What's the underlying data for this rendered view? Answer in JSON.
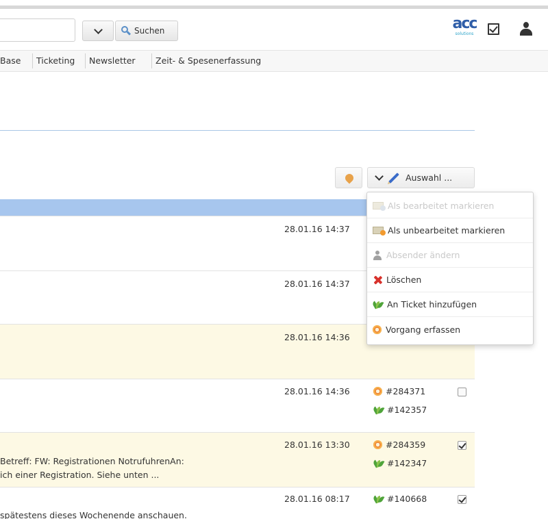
{
  "header": {
    "search_dropdown_icon": "chevron-down-icon",
    "search_button_label": "Suchen",
    "logo_text_main": "acc",
    "logo_text_sub": "solutions"
  },
  "nav": {
    "items": [
      "Base",
      "Ticketing",
      "Newsletter",
      "Zeit- & Spesenerfassung"
    ]
  },
  "toolbar": {
    "select_label": "Auswahl ..."
  },
  "menu": {
    "items": [
      {
        "label": "Als bearbeitet markieren",
        "icon": "mail-icon",
        "disabled": true
      },
      {
        "label": "Als unbearbeitet markieren",
        "icon": "mail-unread-icon",
        "disabled": false
      },
      {
        "label": "Absender ändern",
        "icon": "person-icon",
        "disabled": true
      },
      {
        "label": "Löschen",
        "icon": "delete-x-icon",
        "disabled": false
      },
      {
        "label": "An Ticket hinzufügen",
        "icon": "sprout-icon",
        "disabled": false
      },
      {
        "label": "Vorgang erfassen",
        "icon": "gear-icon",
        "disabled": false
      }
    ]
  },
  "rows": [
    {
      "date": "28.01.16 14:37"
    },
    {
      "date": "28.01.16 14:37"
    },
    {
      "date": "28.01.16 14:36"
    },
    {
      "date": "28.01.16 14:36",
      "ref1": "#284371",
      "ref2": "#142357",
      "checked": false
    },
    {
      "date": "28.01.16 13:30",
      "subject_line1": "Betreff: FW: Registrationen NotrufuhrenAn:",
      "subject_line2": "ich einer Registration. Siehe unten ...",
      "ref1": "#284359",
      "ref2": "#142347",
      "checked": true
    },
    {
      "date": "28.01.16 08:17",
      "subject_line1": "spätestens dieses Wochenende anschauen.",
      "ref1": "#140668",
      "checked": true
    }
  ],
  "colors": {
    "table_header": "#a7c6ee",
    "highlight_row": "#fdf9e4",
    "delete_red": "#d8322c",
    "accent_blue": "#2f5ea8"
  }
}
